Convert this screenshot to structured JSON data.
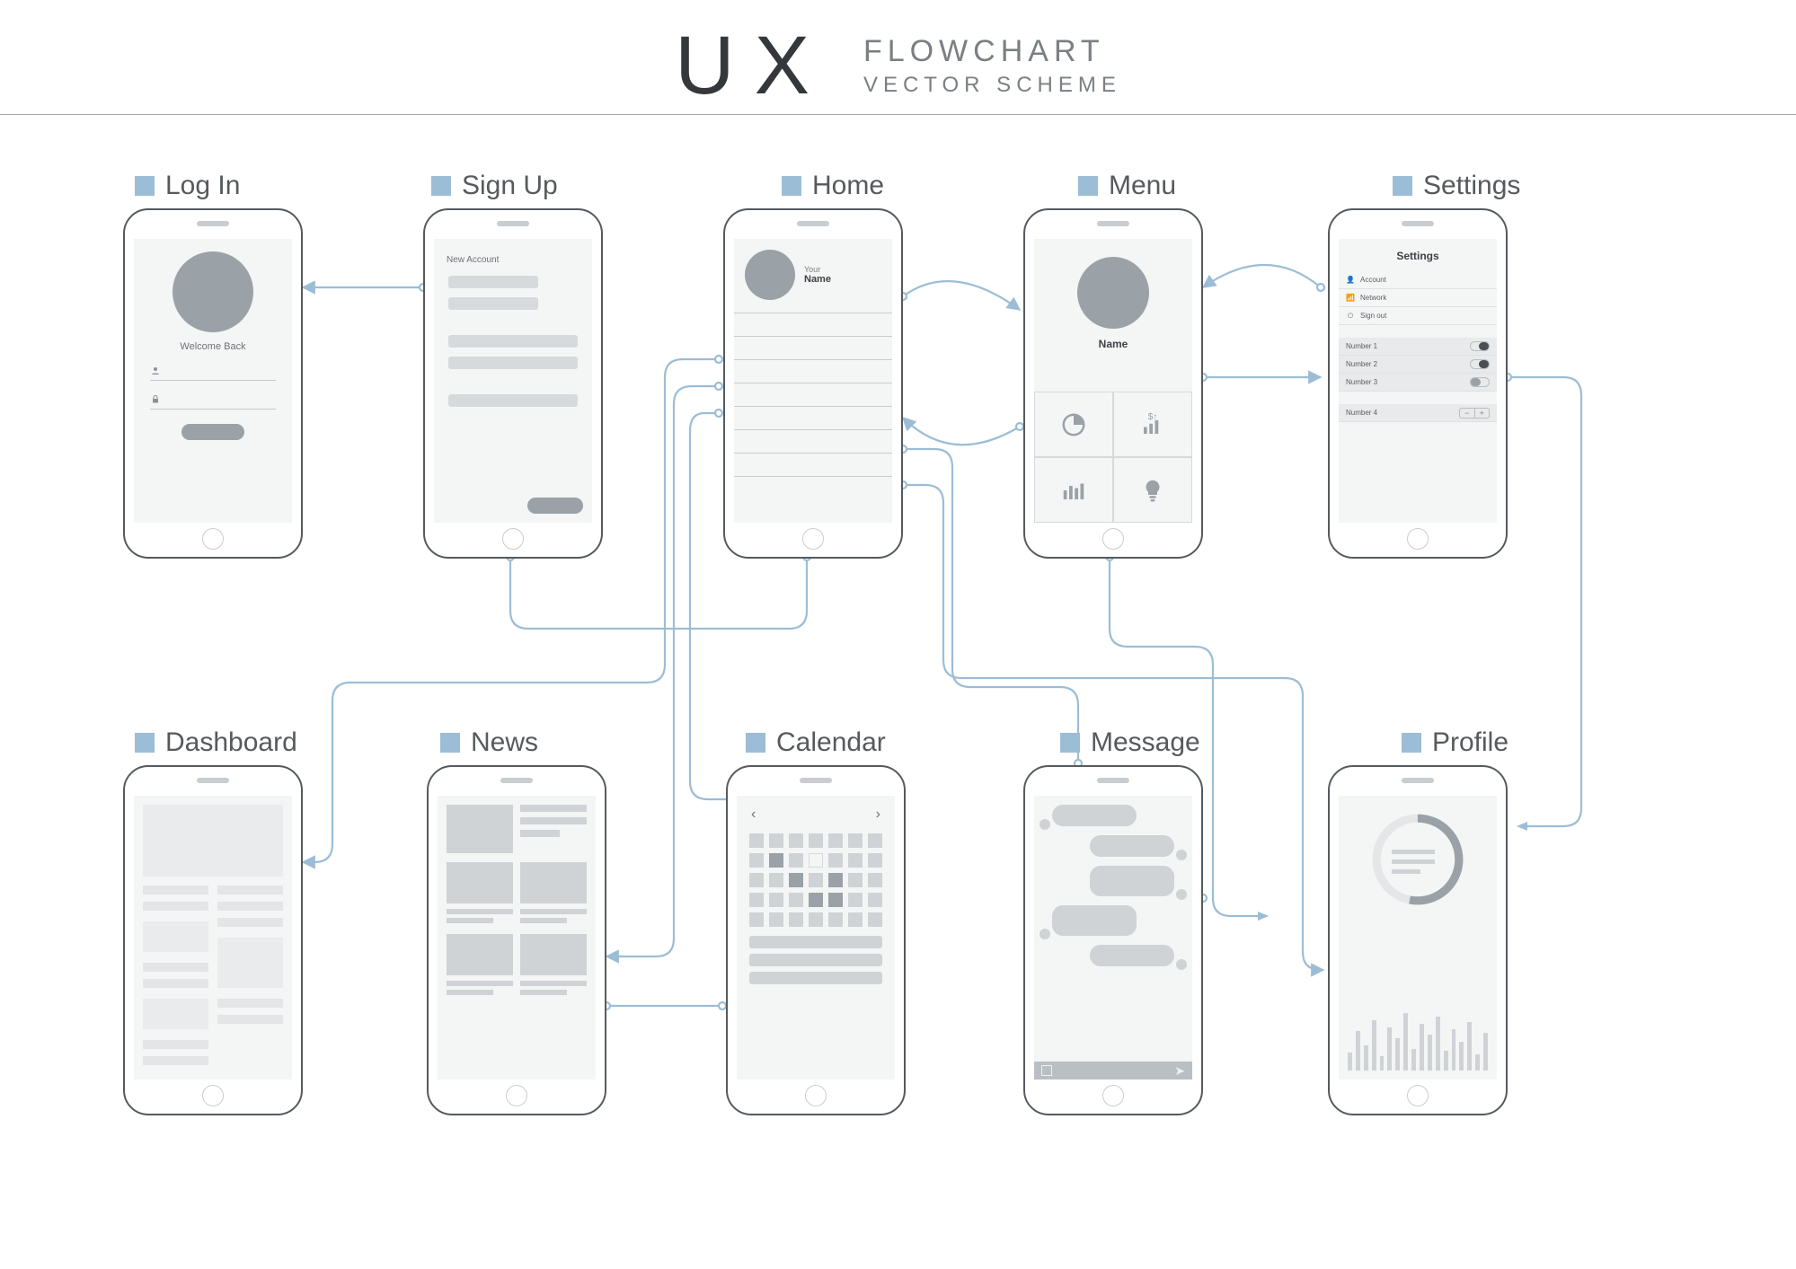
{
  "header": {
    "ux": "UX",
    "line1": "FLOWCHART",
    "line2": "VECTOR SCHEME"
  },
  "labels": {
    "login": "Log In",
    "signup": "Sign Up",
    "home": "Home",
    "menu": "Menu",
    "settings": "Settings",
    "dashboard": "Dashboard",
    "news": "News",
    "calendar": "Calendar",
    "message": "Message",
    "profile": "Profile"
  },
  "login": {
    "welcome": "Welcome Back"
  },
  "signup": {
    "title": "New Account"
  },
  "home": {
    "your": "Your",
    "name": "Name"
  },
  "menu": {
    "name": "Name"
  },
  "settings": {
    "title": "Settings",
    "rows": [
      "Account",
      "Network",
      "Sign out"
    ],
    "toggles": [
      "Number 1",
      "Number 2",
      "Number 3"
    ],
    "stepper": "Number 4"
  },
  "connections": [
    [
      "login",
      "signup"
    ],
    [
      "signup",
      "home"
    ],
    [
      "home",
      "menu"
    ],
    [
      "menu",
      "settings"
    ],
    [
      "home",
      "dashboard"
    ],
    [
      "home",
      "news"
    ],
    [
      "home",
      "calendar"
    ],
    [
      "home",
      "message"
    ],
    [
      "home",
      "profile"
    ],
    [
      "menu",
      "message"
    ],
    [
      "menu",
      "profile"
    ],
    [
      "settings",
      "profile"
    ]
  ]
}
